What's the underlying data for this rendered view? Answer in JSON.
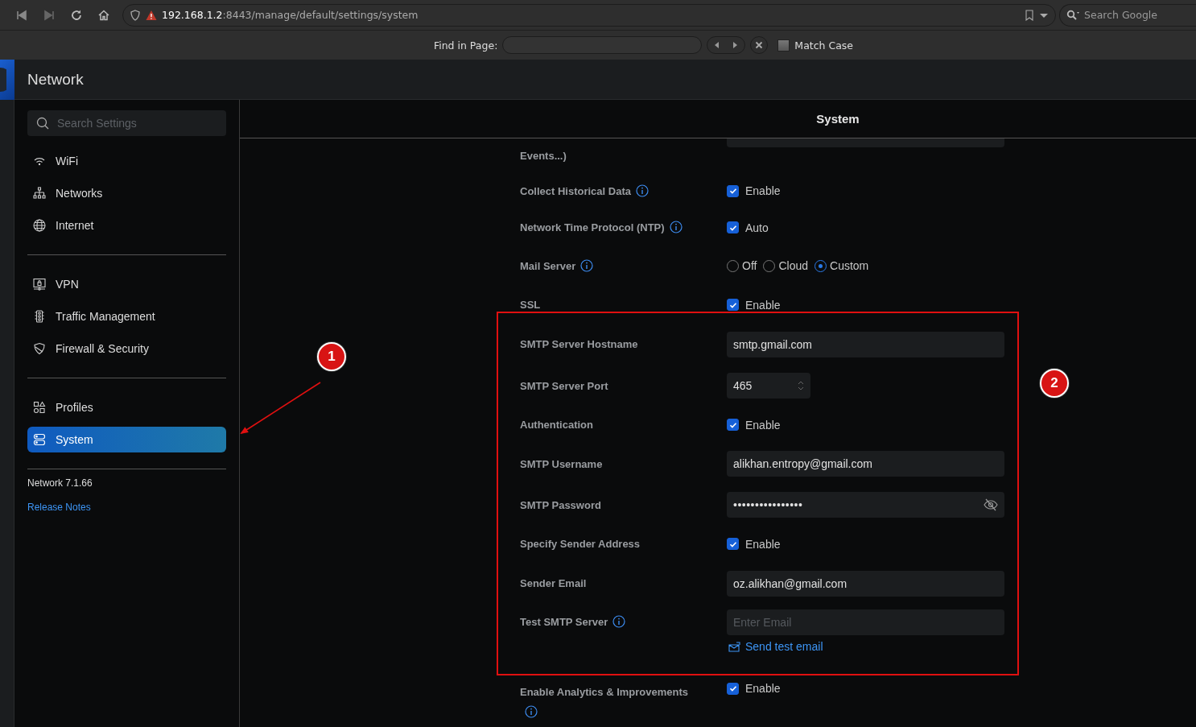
{
  "browser": {
    "url": "**192.168.1.2**:8443/manage/default/settings/system",
    "search_placeholder": "Search Google"
  },
  "find_bar": {
    "label": "Find in Page:",
    "match_case": {
      "label": "Match Case",
      "checked": false
    }
  },
  "app": {
    "title": "Network"
  },
  "sidebar": {
    "search_placeholder": "Search Settings",
    "groups": [
      [
        {
          "label": "WiFi",
          "selected": false
        },
        {
          "label": "Networks",
          "selected": false
        },
        {
          "label": "Internet",
          "selected": false
        }
      ],
      [
        {
          "label": "VPN",
          "selected": false
        },
        {
          "label": "Traffic Management",
          "selected": false
        },
        {
          "label": "Firewall & Security",
          "selected": false
        }
      ],
      [
        {
          "label": "Profiles",
          "selected": false
        },
        {
          "label": "System",
          "selected": true
        }
      ]
    ],
    "version": "Network 7.1.66",
    "link": "Release Notes"
  },
  "main": {
    "title": "System",
    "rows": [
      {
        "kind": "cut",
        "label": "Events...)"
      },
      {
        "kind": "checkbox",
        "label": "Collect Historical Data",
        "info": true,
        "checked": true,
        "option": "Enable"
      },
      {
        "kind": "checkbox",
        "label": "Network Time Protocol (NTP)",
        "info": true,
        "checked": true,
        "option": "Auto"
      },
      {
        "kind": "radio",
        "label": "Mail Server",
        "info": true,
        "options": [
          {
            "label": "Off",
            "selected": false
          },
          {
            "label": "Cloud",
            "selected": false
          },
          {
            "label": "Custom",
            "selected": true
          }
        ]
      },
      {
        "kind": "checkbox",
        "label": "SSL",
        "checked": true,
        "option": "Enable"
      },
      {
        "kind": "text",
        "label": "SMTP Server Hostname",
        "value": "smtp.gmail.com"
      },
      {
        "kind": "number",
        "label": "SMTP Server Port",
        "value": "465"
      },
      {
        "kind": "checkbox",
        "label": "Authentication",
        "checked": true,
        "option": "Enable"
      },
      {
        "kind": "text",
        "label": "SMTP Username",
        "value": "alikhan.entropy@gmail.com"
      },
      {
        "kind": "password",
        "label": "SMTP Password",
        "value": "••••••••••••••••"
      },
      {
        "kind": "checkbox",
        "label": "Specify Sender Address",
        "checked": true,
        "option": "Enable"
      },
      {
        "kind": "text",
        "label": "Sender Email",
        "value": "oz.alikhan@gmail.com"
      },
      {
        "kind": "text",
        "label": "Test SMTP Server",
        "info": true,
        "placeholder": "Enter Email"
      },
      {
        "kind": "link",
        "link": "Send test email"
      },
      {
        "kind": "checkbox",
        "label": "Enable Analytics & Improvements",
        "info": true,
        "checked": true,
        "option": "Enable"
      }
    ]
  },
  "annotations": [
    {
      "label": "1"
    },
    {
      "label": "2"
    }
  ]
}
